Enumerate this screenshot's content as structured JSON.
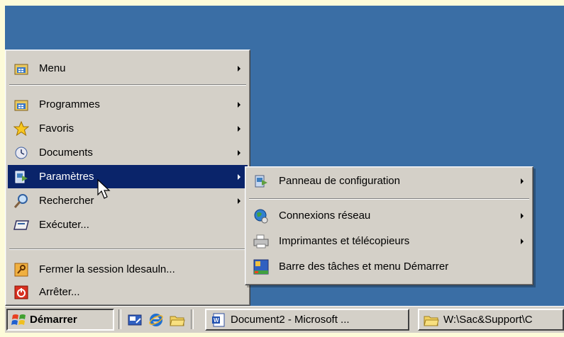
{
  "start_menu": {
    "items": [
      {
        "label": "Menu",
        "icon": "menu-folder-icon",
        "has_submenu": true
      },
      {
        "label": "Programmes",
        "icon": "programs-icon",
        "has_submenu": true
      },
      {
        "label": "Favoris",
        "icon": "favorites-star-icon",
        "has_submenu": true
      },
      {
        "label": "Documents",
        "icon": "documents-icon",
        "has_submenu": true
      },
      {
        "label": "Paramètres",
        "icon": "settings-icon",
        "has_submenu": true,
        "highlighted": true
      },
      {
        "label": "Rechercher",
        "icon": "search-magnifier-icon",
        "has_submenu": true
      },
      {
        "label": "Exécuter...",
        "icon": "run-icon",
        "has_submenu": false
      },
      {
        "label": "Fermer la session ldesauln...",
        "icon": "logoff-key-icon",
        "has_submenu": false
      },
      {
        "label": "Arrêter...",
        "icon": "shutdown-icon",
        "has_submenu": false
      }
    ]
  },
  "settings_submenu": {
    "items": [
      {
        "label": "Panneau de configuration",
        "icon": "control-panel-icon",
        "has_submenu": true
      },
      {
        "label": "Connexions réseau",
        "icon": "network-globe-icon",
        "has_submenu": true
      },
      {
        "label": "Imprimantes et télécopieurs",
        "icon": "printer-icon",
        "has_submenu": true
      },
      {
        "label": "Barre des tâches et menu Démarrer",
        "icon": "taskbar-icon",
        "has_submenu": false
      }
    ]
  },
  "taskbar": {
    "start_label": "Démarrer",
    "quick_launch": [
      "desktop-icon",
      "internet-explorer-icon",
      "explorer-folder-icon"
    ],
    "tasks": [
      {
        "label": "Document2 - Microsoft ...",
        "icon": "word-document-icon"
      },
      {
        "label": "W:\\Sac&Support\\C",
        "icon": "explorer-folder-icon"
      }
    ]
  },
  "colors": {
    "desktop": "#3a6ea5",
    "menu_face": "#d4d0c8",
    "highlight": "#0a246a",
    "page_background": "#fdfbd9"
  }
}
